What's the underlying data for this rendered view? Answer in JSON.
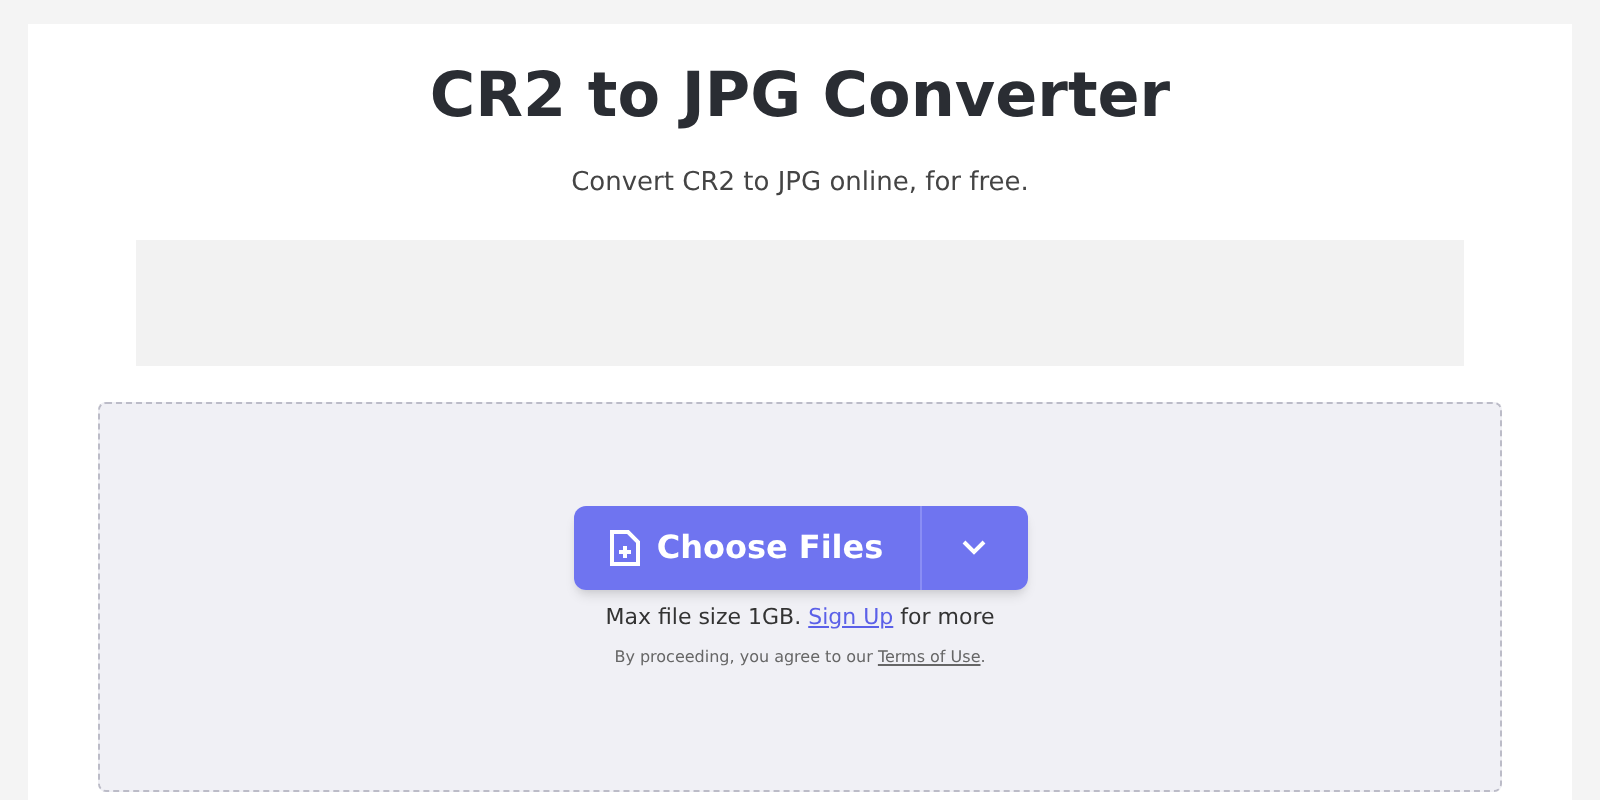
{
  "title": "CR2 to JPG Converter",
  "subtitle": "Convert CR2 to JPG online, for free.",
  "upload": {
    "button": "Choose Files",
    "limit": {
      "before": "Max file size 1GB.",
      "link": "Sign Up",
      "after": "for more"
    },
    "terms": {
      "before": "By proceeding, you agree to our",
      "link": "Terms of Use",
      "after": "."
    }
  }
}
